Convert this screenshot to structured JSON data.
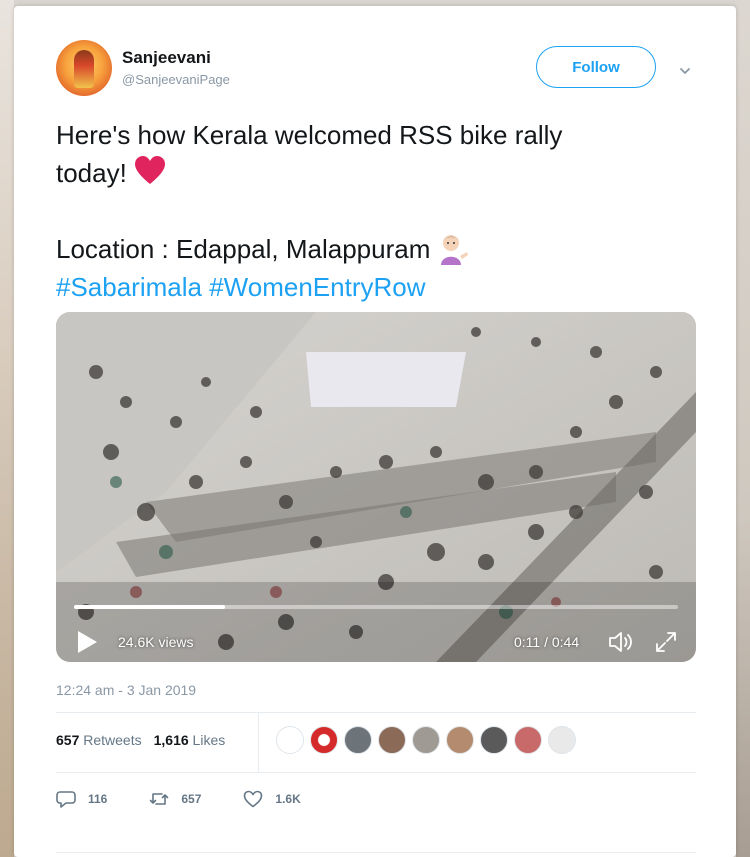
{
  "author": {
    "display_name": "Sanjeevani",
    "handle": "@SanjeevaniPage",
    "avatar_icon": "deity-avatar-icon"
  },
  "follow_button": {
    "label": "Follow"
  },
  "menu_icon": "chevron-down-icon",
  "tweet": {
    "line1": "Here's how Kerala welcomed RSS bike rally",
    "line2": "today!",
    "line3": "Location : Edappal, Malappuram",
    "hashtag1": "#Sabarimala",
    "hashtag2": "#WomenEntryRow",
    "emoji_line2": "red-heart-icon",
    "emoji_line3": "woman-tipping-hand-icon"
  },
  "video": {
    "views": "24.6K views",
    "time": "0:11 / 0:44",
    "progress": 0.25
  },
  "timestamp": "12:24 am - 3 Jan 2019",
  "stats": {
    "retweets_count": "657",
    "retweets_label": "Retweets",
    "likes_count": "1,616",
    "likes_label": "Likes"
  },
  "actions": {
    "replies": "116",
    "retweets": "657",
    "likes": "1.6K"
  },
  "colors": {
    "accent": "#1da1f2",
    "text": "#14171a",
    "muted": "#8a98a6",
    "heart": "#e0245e"
  }
}
